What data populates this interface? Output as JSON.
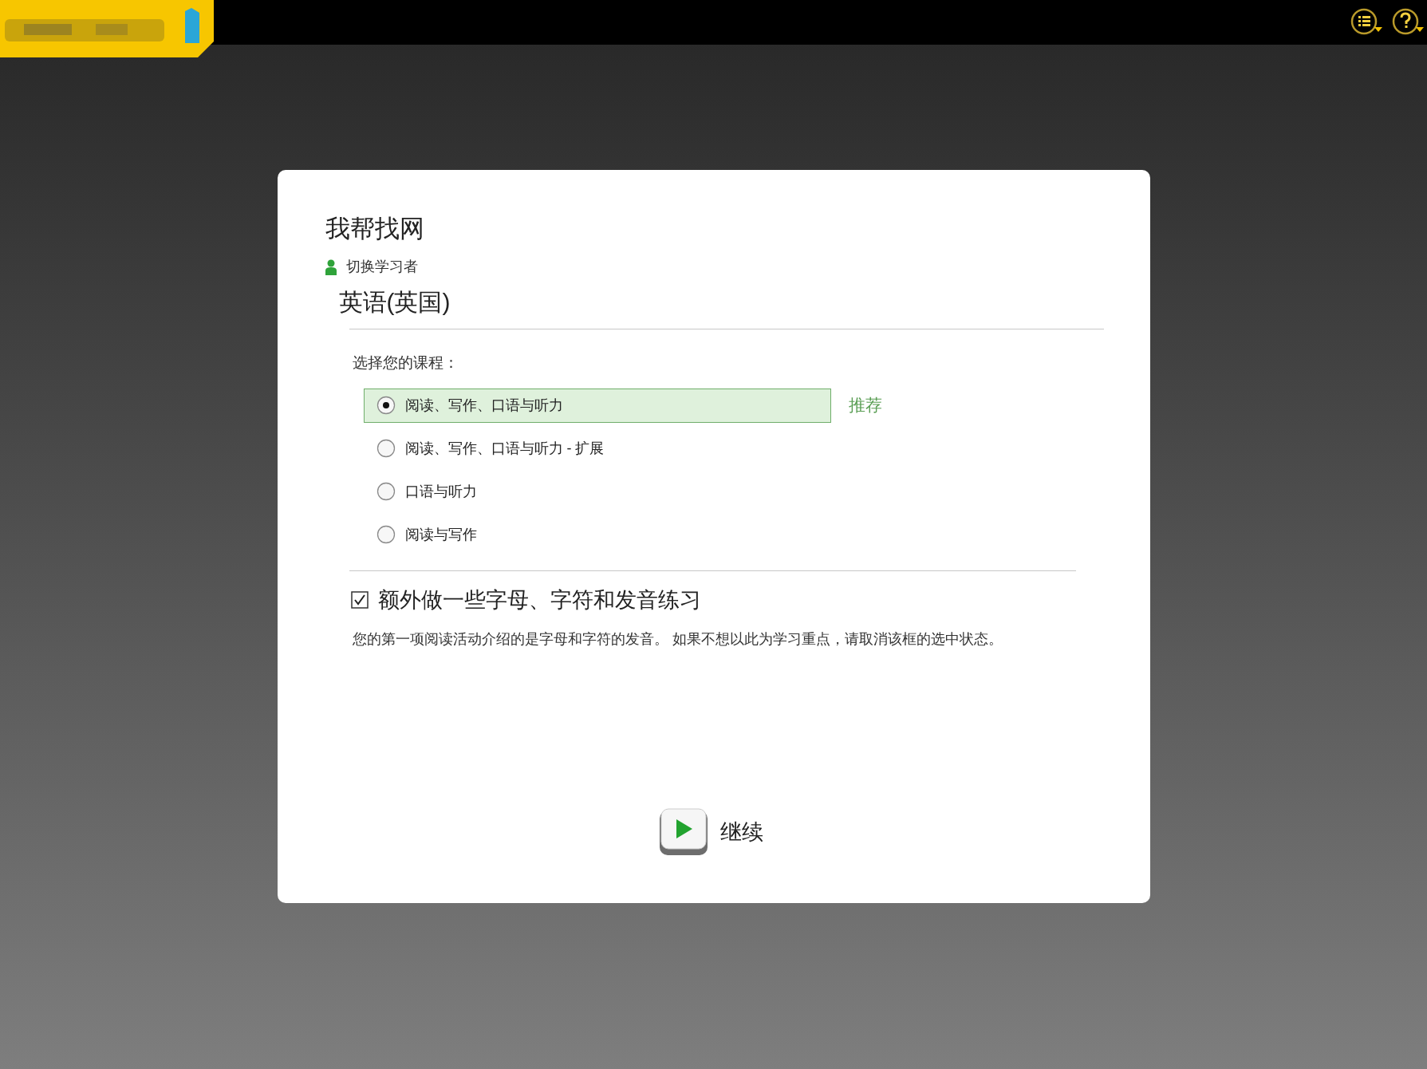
{
  "dialog": {
    "title": "我帮找网",
    "switch_learner": "切换学习者",
    "language": "英语(英国)",
    "course_prompt": "选择您的课程：",
    "courses": [
      {
        "label": "阅读、写作、口语与听力",
        "selected": true,
        "badge": "推荐"
      },
      {
        "label": "阅读、写作、口语与听力 - 扩展",
        "selected": false
      },
      {
        "label": "口语与听力",
        "selected": false
      },
      {
        "label": "阅读与写作",
        "selected": false
      }
    ],
    "extra_practice": {
      "label": "额外做一些字母、字符和发音练习",
      "checked": true
    },
    "description": "您的第一项阅读活动介绍的是字母和字符的发音。 如果不想以此为学习重点，请取消该框的选中状态。",
    "continue": "继续"
  }
}
